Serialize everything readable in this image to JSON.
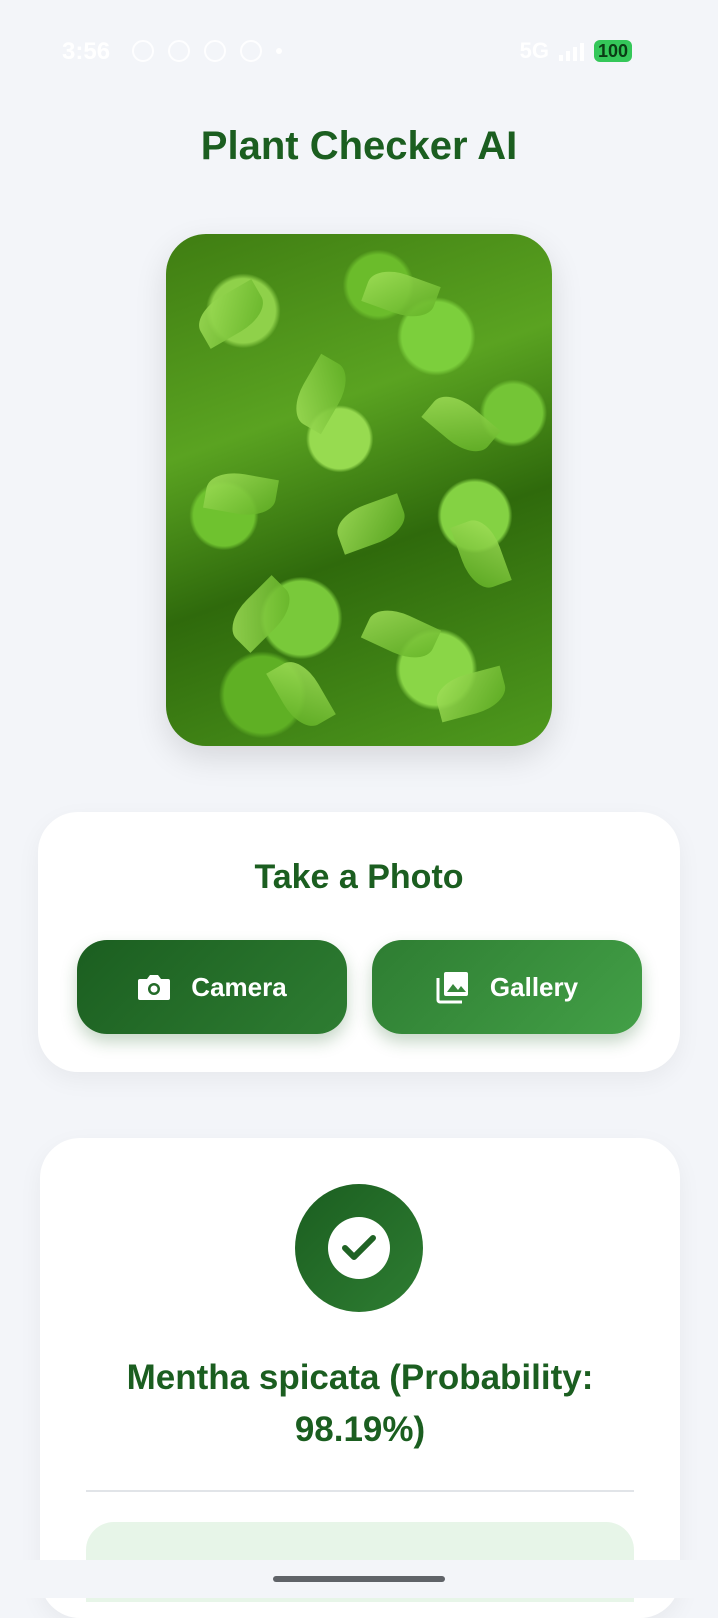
{
  "status_bar": {
    "time": "3:56",
    "network": "5G",
    "battery": "100"
  },
  "app": {
    "title": "Plant Checker AI"
  },
  "photo_section": {
    "title": "Take a Photo",
    "camera_label": "Camera",
    "gallery_label": "Gallery"
  },
  "result": {
    "text": "Mentha spicata (Probability: 98.19%)"
  },
  "colors": {
    "primary": "#1b5e20",
    "accent": "#43a047",
    "background": "#f3f5f9",
    "result_box": "#e7f5e8"
  },
  "icons": [
    "camera-icon",
    "gallery-icon",
    "check-icon"
  ]
}
